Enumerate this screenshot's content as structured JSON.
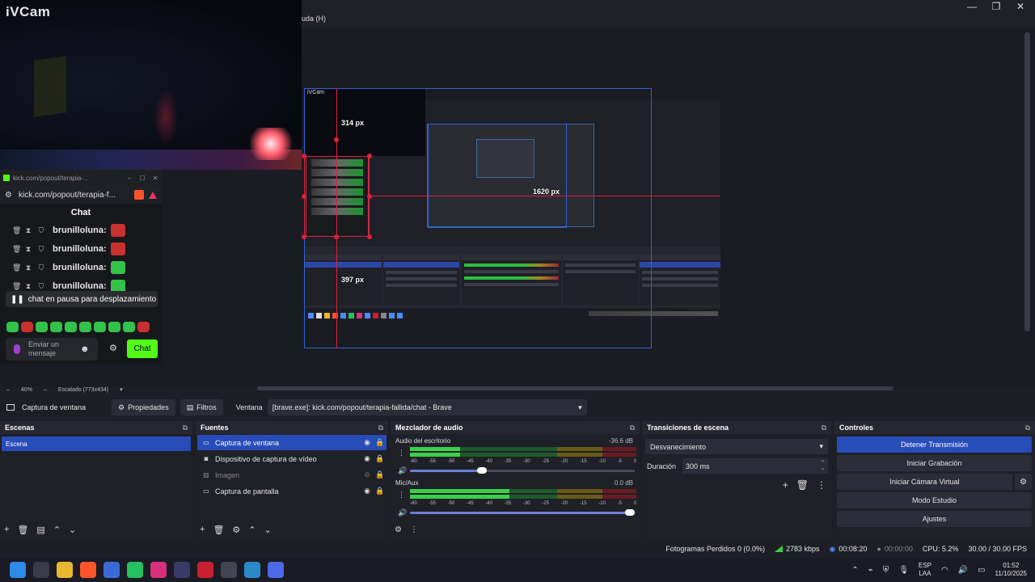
{
  "window": {
    "menu_fragment": "uda (H)",
    "controls": [
      "—",
      "❐",
      "✕"
    ]
  },
  "webcam": {
    "title": "iVCam"
  },
  "chat_window": {
    "tab_title": "kick.com/popout/terapia-...",
    "url": "kick.com/popout/terapia-f...",
    "heading": "Chat",
    "messages": [
      {
        "user": "brunilloluna:",
        "emote_color": "#c8322e"
      },
      {
        "user": "brunilloluna:",
        "emote_color": "#c8322e"
      },
      {
        "user": "brunilloluna:",
        "emote_color": "#33c24a"
      },
      {
        "user": "brunilloluna:",
        "emote_color": "#33c24a"
      }
    ],
    "paused_text": "chat en pausa para desplazamiento",
    "input_placeholder": "Enviar un mensaje",
    "send_label": "Chat",
    "accent": "#53fc18"
  },
  "nested_capture": {
    "webcam_title": "iVCam",
    "measure_top": "314 px",
    "measure_bottom": "397 px",
    "measure_right": "1620 px"
  },
  "zoom": {
    "level": "40%",
    "scaling": "Escalado (773x434)"
  },
  "source_toolbar": {
    "source_name": "Captura de ventana",
    "properties_label": "Propiedades",
    "filters_label": "Filtros",
    "window_label": "Ventana",
    "window_value": "[brave.exe]: kick.com/popout/terapia-fallida/chat - Brave"
  },
  "scenes": {
    "title": "Escenas",
    "items": [
      "Escena"
    ]
  },
  "sources": {
    "title": "Fuentes",
    "items": [
      {
        "name": "Captura de ventana",
        "icon": "window-icon",
        "selected": true,
        "visible": true
      },
      {
        "name": "Dispositivo de captura de vídeo",
        "icon": "camera-icon",
        "selected": false,
        "visible": true
      },
      {
        "name": "Imagen",
        "icon": "image-icon",
        "selected": false,
        "visible": false
      },
      {
        "name": "Captura de pantalla",
        "icon": "monitor-icon",
        "selected": false,
        "visible": true
      }
    ]
  },
  "mixer": {
    "title": "Mezclador de audio",
    "scale": [
      "-60",
      "-55",
      "-50",
      "-45",
      "-40",
      "-35",
      "-30",
      "-25",
      "-20",
      "-15",
      "-10",
      "-5",
      "0"
    ],
    "channels": [
      {
        "name": "Audio del escritorio",
        "db": "-36.6 dB",
        "level": 0.22,
        "volume": 0.32
      },
      {
        "name": "Mic/Aux",
        "db": "0.0 dB",
        "level": 0.44,
        "volume": 1.0
      }
    ]
  },
  "transitions": {
    "title": "Transiciones de escena",
    "selected": "Desvanecimiento",
    "duration_label": "Duración",
    "duration_value": "300 ms"
  },
  "controls": {
    "title": "Controles",
    "stop_stream": "Detener Transmisión",
    "start_recording": "Iniciar Grabación",
    "start_virtual_cam": "Iniciar Cámara Virtual",
    "studio_mode": "Modo Estudio",
    "settings": "Ajustes",
    "primary_color": "#284cb8"
  },
  "status": {
    "dropped_frames": "Fotogramas Perdidos 0 (0.0%)",
    "bitrate": "2783 kbps",
    "stream_time": "00:08:20",
    "rec_time": "00:00:00",
    "cpu": "CPU: 5.2%",
    "fps": "30.00 / 30.00 FPS"
  },
  "taskbar": {
    "apps": [
      {
        "name": "windows-start",
        "color": "#2f8ae8"
      },
      {
        "name": "task-view",
        "color": "#3a3b48"
      },
      {
        "name": "file-explorer",
        "color": "#e8b830"
      },
      {
        "name": "brave",
        "color": "#fb542b"
      },
      {
        "name": "store",
        "color": "#3a6ad8"
      },
      {
        "name": "whatsapp",
        "color": "#25c060"
      },
      {
        "name": "instagram",
        "color": "#d8307a"
      },
      {
        "name": "dropbox-like",
        "color": "#3a3b68"
      },
      {
        "name": "red-app",
        "color": "#c82030"
      },
      {
        "name": "obs",
        "color": "#444550"
      },
      {
        "name": "app-cyan",
        "color": "#2a8ac8"
      },
      {
        "name": "app-blue",
        "color": "#4a6ae8"
      }
    ],
    "lang": "ESP",
    "lang2": "LAA",
    "time": "01:52",
    "date": "11/10/2025"
  }
}
